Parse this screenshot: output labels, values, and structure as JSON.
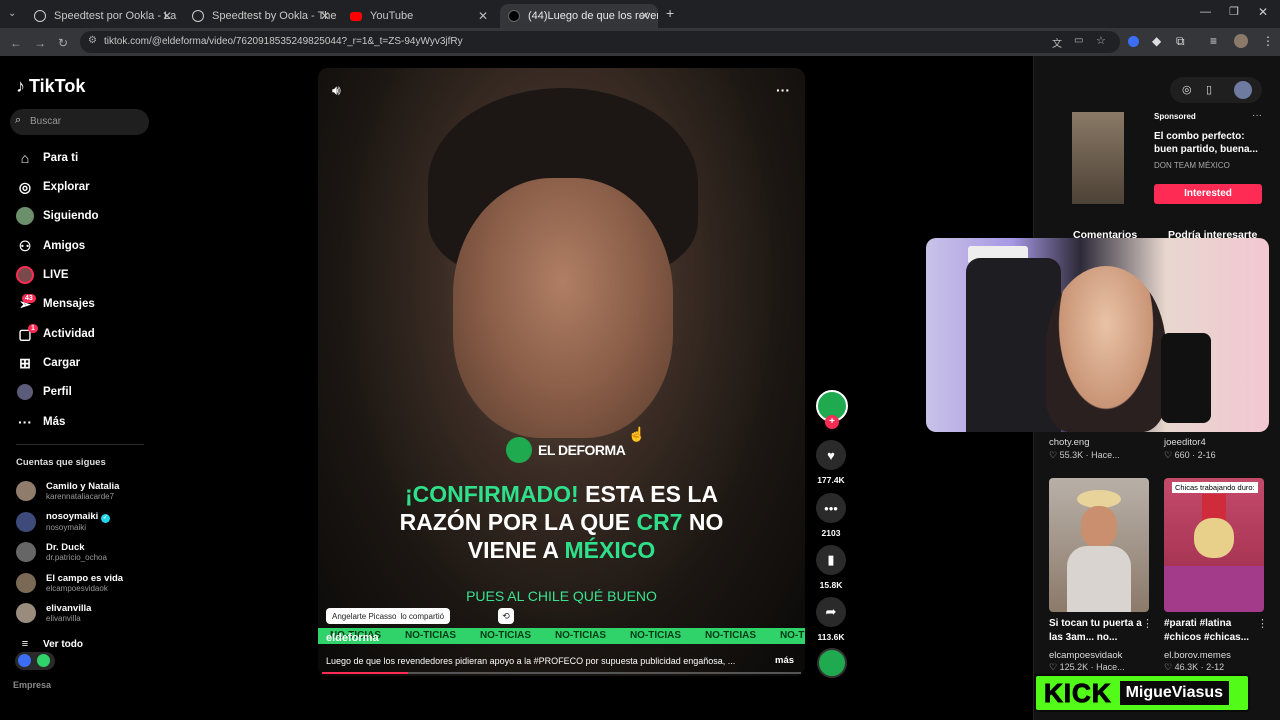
{
  "browser": {
    "tabs": [
      {
        "title": "Speedtest por Ookla - La prueba"
      },
      {
        "title": "Speedtest by Ookla - The Globa"
      },
      {
        "title": "YouTube"
      },
      {
        "title": "(44)Luego de que los reven"
      }
    ],
    "url": "tiktok.com/@eldeforma/video/7620918535249825044?_r=1&_t=ZS-94yWyv3jfRy"
  },
  "sidebar": {
    "logo": "TikTok",
    "search_placeholder": "Buscar",
    "nav": [
      {
        "label": "Para ti",
        "icon": "home-icon"
      },
      {
        "label": "Explorar",
        "icon": "compass-icon"
      },
      {
        "label": "Siguiendo",
        "icon": "following-avatar-icon"
      },
      {
        "label": "Amigos",
        "icon": "friends-icon"
      },
      {
        "label": "LIVE",
        "icon": "live-icon"
      },
      {
        "label": "Mensajes",
        "icon": "messages-icon",
        "badge": "43"
      },
      {
        "label": "Actividad",
        "icon": "activity-icon",
        "badge": "1"
      },
      {
        "label": "Cargar",
        "icon": "upload-icon"
      },
      {
        "label": "Perfil",
        "icon": "profile-icon"
      },
      {
        "label": "Más",
        "icon": "more-icon"
      }
    ],
    "following_title": "Cuentas que sigues",
    "following": [
      {
        "name": "Camilo y Natalia",
        "handle": "karennataliacarde7"
      },
      {
        "name": "nosoymaiki",
        "handle": "nosoymaiki"
      },
      {
        "name": "Dr. Duck",
        "handle": "dr.patricio_ochoa"
      },
      {
        "name": "El campo es vida",
        "handle": "elcampoesvidaok"
      },
      {
        "name": "elivanvilla",
        "handle": "elivanvilla"
      }
    ],
    "see_all": "Ver todo",
    "footer": "Empresa"
  },
  "video": {
    "brand": "EL DEFORMA",
    "headline_1a": "¡CONFIRMADO!",
    "headline_1b": " ESTA ES LA",
    "headline_2a": "RAZÓN POR LA QUE ",
    "headline_2b": "CR7",
    "headline_2c": " NO",
    "headline_3a": "VIENE A ",
    "headline_3b": "MÉXICO",
    "subline": "PUES AL CHILE QUÉ BUENO",
    "shared_by": "Angelarte Picasso",
    "shared_label": "lo compartió",
    "ticker_item": "NO-TICIAS",
    "author": "eldeforma",
    "caption": "Luego de que los revendedores pidieran apoyo a la #PROFECO por supuesta publicidad engañosa, ...",
    "more": "más",
    "progress": 0.18
  },
  "actions": {
    "likes": "177.4K",
    "comments": "2103",
    "saves": "15.8K",
    "shares": "113.6K"
  },
  "ad": {
    "sponsored": "Sponsored",
    "title": "El combo perfecto: buen partido, buena...",
    "brand": "DON TEAM MÉXICO",
    "cta": "Interested"
  },
  "right_tabs": {
    "comments": "Comentarios",
    "related": "Podría interesarte"
  },
  "related": [
    {
      "user": "choty.eng",
      "stats": "55.3K · Hace..."
    },
    {
      "user": "joeeditor4",
      "stats": "660 · 2-16"
    },
    {
      "title": "Si tocan tu puerta a las 3am... no...",
      "user": "elcampoesvidaok",
      "stats": "125.2K · Hace..."
    },
    {
      "title": "#parati #latina #chicos #chicas...",
      "user": "el.borov.memes",
      "stats": "46.3K · 2-12",
      "overlay": "Chicas trabajando duro:"
    }
  ],
  "kick": {
    "logo": "KICK",
    "name": "MigueViasus"
  },
  "colors": {
    "accent": "#fe2c55",
    "deforma_green": "#2fe08a",
    "kick_green": "#53fc18"
  }
}
